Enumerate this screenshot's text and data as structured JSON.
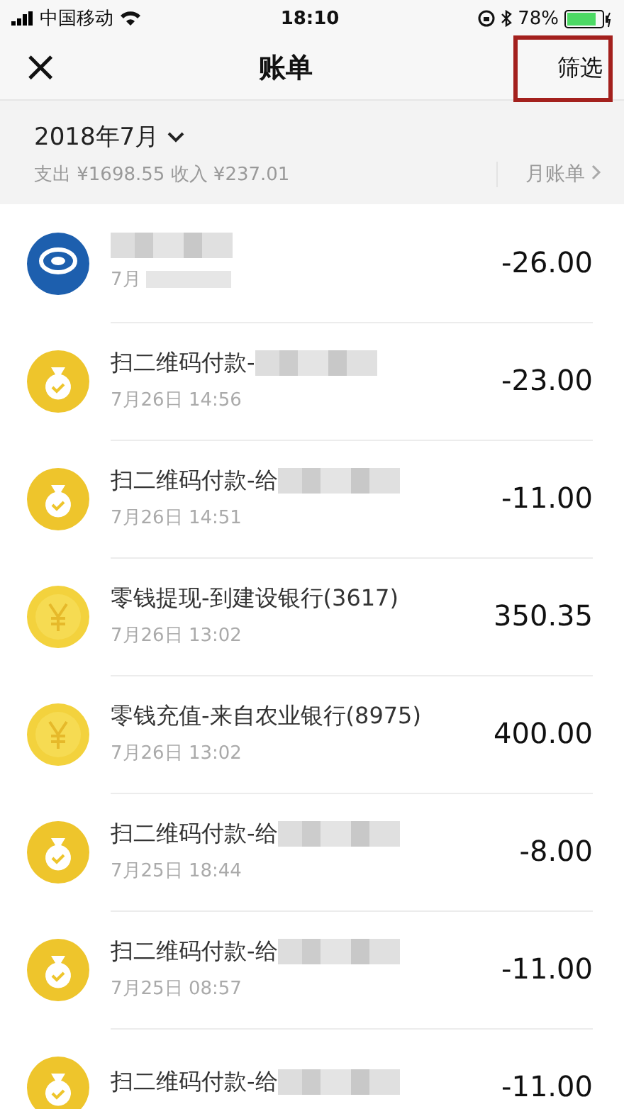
{
  "status_bar": {
    "carrier": "中国移动",
    "time": "18:10",
    "battery": "78%"
  },
  "nav": {
    "close": "×",
    "title": "账单",
    "action": "筛选",
    "action_highlighted": true
  },
  "summary": {
    "month": "2018年7月",
    "totals": "支出 ¥1698.55 收入 ¥237.01",
    "monthly_bill": "月账单"
  },
  "rows": [
    {
      "kind": "bank",
      "title": "",
      "title_blurred": true,
      "time": "7月",
      "time_blurred": true,
      "amount": "-26.00"
    },
    {
      "kind": "payment",
      "title": "扫二维码付款-",
      "title_blurred": true,
      "time": "7月26日 14:56",
      "time_blurred": false,
      "amount": "-23.00"
    },
    {
      "kind": "payment",
      "title": "扫二维码付款-给",
      "title_blurred": true,
      "time": "7月26日 14:51",
      "time_blurred": false,
      "amount": "-11.00"
    },
    {
      "kind": "change",
      "title": "零钱提现-到建设银行(3617)",
      "title_blurred": false,
      "time": "7月26日 13:02",
      "time_blurred": false,
      "amount": "350.35"
    },
    {
      "kind": "change",
      "title": "零钱充值-来自农业银行(8975)",
      "title_blurred": false,
      "time": "7月26日 13:02",
      "time_blurred": false,
      "amount": "400.00"
    },
    {
      "kind": "payment",
      "title": "扫二维码付款-给",
      "title_blurred": true,
      "time": "7月25日 18:44",
      "time_blurred": false,
      "amount": "-8.00"
    },
    {
      "kind": "payment",
      "title": "扫二维码付款-给",
      "title_blurred": true,
      "time": "7月25日 08:57",
      "time_blurred": false,
      "amount": "-11.00"
    },
    {
      "kind": "payment",
      "title": "扫二维码付款-给",
      "title_blurred": true,
      "time": "",
      "time_blurred": false,
      "amount": "-11.00"
    }
  ]
}
